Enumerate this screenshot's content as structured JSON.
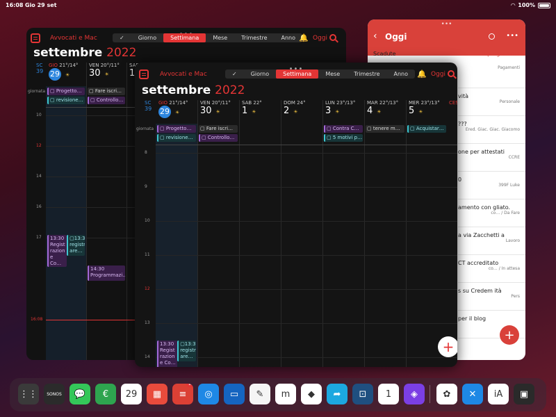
{
  "status": {
    "time": "16:08",
    "date": "Gio 29 set",
    "battery": "100%"
  },
  "calendar": {
    "calendar_name": "Avvocati e Mac",
    "segments": [
      "Giorno",
      "Settimana",
      "Mese",
      "Trimestre",
      "Anno"
    ],
    "active_segment": "Settimana",
    "today_label": "Oggi",
    "month": "settembre",
    "year": "2022",
    "week_label": "SC",
    "week_num": "39",
    "allday_label": "giornata",
    "days": [
      {
        "dow": "GIO",
        "num": "29",
        "temp": "21°/14°",
        "today": true
      },
      {
        "dow": "VEN",
        "num": "30",
        "temp": "20°/11°"
      },
      {
        "dow": "SAB",
        "num": "1",
        "temp": "22°"
      },
      {
        "dow": "DOM",
        "num": "2",
        "temp": "24°"
      },
      {
        "dow": "LUN",
        "num": "3",
        "temp": "23°/13°"
      },
      {
        "dow": "MAR",
        "num": "4",
        "temp": "22°/13°"
      },
      {
        "dow": "MER",
        "num": "5",
        "temp": "23°/13°"
      }
    ],
    "tz": "CEST",
    "hours_front": [
      "8",
      "9",
      "10",
      "11",
      "12",
      "13",
      "14"
    ],
    "hours_back": [
      "10",
      "12",
      "14",
      "16",
      "17"
    ],
    "now": "16:08",
    "allday_events": [
      {
        "day": 0,
        "row": 0,
        "text": "Progetto…",
        "kind": "purple"
      },
      {
        "day": 0,
        "row": 1,
        "text": "revisione…",
        "kind": "teal"
      },
      {
        "day": 1,
        "row": 0,
        "text": "Fare iscri…",
        "kind": "gray"
      },
      {
        "day": 1,
        "row": 1,
        "text": "Controllo…",
        "kind": "purple"
      },
      {
        "day": 4,
        "row": 0,
        "text": "Contra C…",
        "kind": "purple"
      },
      {
        "day": 4,
        "row": 1,
        "text": "5 motivi p…",
        "kind": "teal"
      },
      {
        "day": 5,
        "row": 0,
        "text": "tenere m…",
        "kind": "gray"
      },
      {
        "day": 6,
        "row": 0,
        "text": "Acquistar…",
        "kind": "teal"
      }
    ],
    "timed_events": [
      {
        "time": "13:30",
        "title": "Regist razion e Co…"
      },
      {
        "time": "13:30",
        "title": "registr are…"
      },
      {
        "time": "14:30",
        "title": "Programmazi…"
      }
    ]
  },
  "side": {
    "title": "Oggi",
    "section": "Scadute",
    "reschedule": "Riprogramma",
    "tasks": [
      {
        "title": "",
        "meta": "Pagamenti"
      },
      {
        "title": "vità",
        "meta": "Personale"
      },
      {
        "title": "???",
        "meta": "Ered. Giac. Giac. Giacomo"
      },
      {
        "title": "one per attestati",
        "meta": "CCRE"
      },
      {
        "title": "0",
        "meta": "399F Luke"
      },
      {
        "title": "amento con gliato.",
        "meta": "co… / Da Fare"
      },
      {
        "title": "a via Zacchetti a",
        "meta": "Lavoro"
      },
      {
        "title": "CT accreditato",
        "meta": "co… / In attesa"
      },
      {
        "title": "s su Credem ità",
        "meta": "Pers"
      },
      {
        "title": "per il blog",
        "meta": ""
      }
    ]
  },
  "dock": {
    "apps": [
      {
        "name": "app-library",
        "color": "#3a3a3a",
        "label": "⋮⋮"
      },
      {
        "name": "sonos",
        "color": "#2b2b2b",
        "label": "SONOS"
      },
      {
        "name": "messages",
        "color": "#34c759",
        "label": "💬"
      },
      {
        "name": "money",
        "color": "#2ea44f",
        "label": "€"
      },
      {
        "name": "calendar",
        "color": "#ffffff",
        "label": "29"
      },
      {
        "name": "fantastical",
        "color": "#e84b3c",
        "label": "▦"
      },
      {
        "name": "todoist",
        "color": "#db4035",
        "label": "≡",
        "badge": "20"
      },
      {
        "name": "safari",
        "color": "#1e88e5",
        "label": "◎"
      },
      {
        "name": "files",
        "color": "#1565c0",
        "label": "▭"
      },
      {
        "name": "notes",
        "color": "#f5f5f5",
        "label": "✎"
      },
      {
        "name": "monday",
        "color": "#ffffff",
        "label": "m"
      },
      {
        "name": "prisma",
        "color": "#ffffff",
        "label": "◆"
      },
      {
        "name": "share",
        "color": "#1ca8e0",
        "label": "➦"
      },
      {
        "name": "screens",
        "color": "#1f4f80",
        "label": "⊡"
      },
      {
        "name": "1password",
        "color": "#ffffff",
        "label": "1"
      },
      {
        "name": "shortcuts",
        "color": "#7b3fe4",
        "label": "◈"
      },
      {
        "name": "photos",
        "color": "#ffffff",
        "label": "✿"
      },
      {
        "name": "testflight",
        "color": "#1e88e5",
        "label": "✕"
      },
      {
        "name": "ia-writer",
        "color": "#ffffff",
        "label": "iA"
      },
      {
        "name": "recents",
        "color": "#2a2a2a",
        "label": "▣"
      }
    ]
  }
}
